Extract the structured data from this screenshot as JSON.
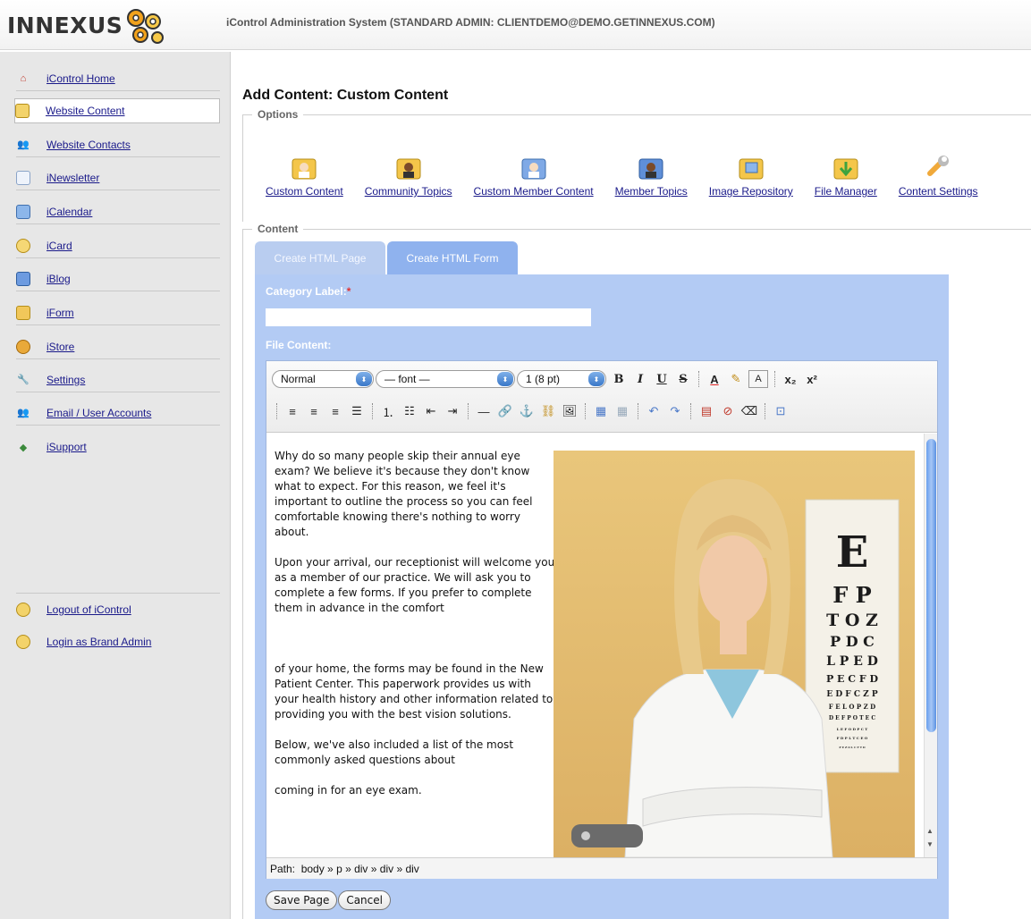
{
  "header": {
    "logo_text": "INNEXUS",
    "title": "iControl Administration System (STANDARD ADMIN: CLIENTDEMO@DEMO.GETINNEXUS.COM)"
  },
  "sidebar": {
    "items": [
      {
        "label": "iControl Home",
        "icon": "home-icon"
      },
      {
        "label": "Website Content",
        "icon": "folder-icon"
      },
      {
        "label": "Website Contacts",
        "icon": "contacts-icon"
      },
      {
        "label": "iNewsletter",
        "icon": "newsletter-icon"
      },
      {
        "label": "iCalendar",
        "icon": "calendar-icon"
      },
      {
        "label": "iCard",
        "icon": "card-icon"
      },
      {
        "label": "iBlog",
        "icon": "blog-icon"
      },
      {
        "label": "iForm",
        "icon": "form-icon"
      },
      {
        "label": "iStore",
        "icon": "store-icon"
      },
      {
        "label": "Settings",
        "icon": "wrench-icon"
      },
      {
        "label": "Email / User Accounts",
        "icon": "users-icon"
      },
      {
        "label": "iSupport",
        "icon": "support-icon"
      }
    ],
    "bottom_items": [
      {
        "label": "Logout of iControl",
        "icon": "logout-icon"
      },
      {
        "label": "Login as Brand Admin",
        "icon": "admin-icon"
      }
    ]
  },
  "main": {
    "title": "Add Content: Custom Content",
    "options_legend": "Options",
    "options": [
      {
        "label": "Custom Content",
        "icon": "custom-content-icon"
      },
      {
        "label": "Community Topics",
        "icon": "community-topics-icon"
      },
      {
        "label": "Custom Member Content",
        "icon": "custom-member-content-icon"
      },
      {
        "label": "Member Topics",
        "icon": "member-topics-icon"
      },
      {
        "label": "Image Repository",
        "icon": "image-repository-icon"
      },
      {
        "label": "File Manager",
        "icon": "file-manager-icon"
      },
      {
        "label": "Content Settings",
        "icon": "content-settings-icon"
      }
    ],
    "content_legend": "Content",
    "tabs": [
      {
        "label": "Create HTML Page"
      },
      {
        "label": "Create HTML Form"
      }
    ],
    "category_label": "Category Label:",
    "required_mark": "*",
    "category_value": "",
    "file_content_label": "File Content:"
  },
  "editor": {
    "format_select": "Normal",
    "font_select": "— font —",
    "size_select": "1 (8 pt)",
    "paragraphs": [
      "Why do so many people skip their annual eye exam? We believe it's because they don't know what to expect. For this reason, we feel it's important to outline the process so you can feel comfortable knowing there's nothing to worry about.",
      "Upon your arrival, our receptionist will welcome you as a member of our practice.  We will ask you to complete a few forms.  If you prefer to complete them in advance in the comfort",
      "",
      "of your home, the forms may be found in the New Patient Center.  This paperwork provides us with your health history and other information related to providing you with the best vision solutions.",
      "Below, we've also included a list of the most commonly asked questions about",
      "coming in for an eye exam."
    ],
    "eye_chart": {
      "rows": [
        "E",
        "F P",
        "T O Z",
        "P D C",
        "L P E D",
        "P E C F D",
        "E D F C Z P",
        "F E L O P Z D",
        "D E F P O T E C",
        "L E F O D P C T",
        "F D P L T C E O",
        "P E Z O L C F T D"
      ]
    },
    "path_label": "Path:",
    "path_value": "body » p » div » div » div",
    "save_label": "Save Page",
    "cancel_label": "Cancel"
  }
}
